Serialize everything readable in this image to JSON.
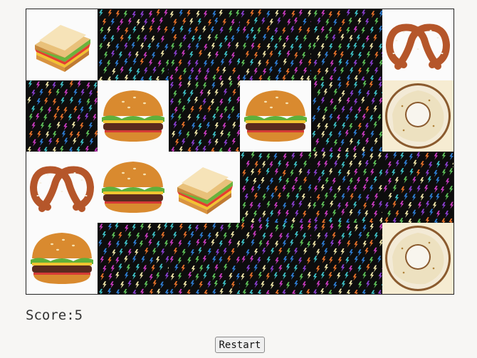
{
  "board": {
    "columns": 6,
    "rows": 4,
    "tiles": [
      "sandwich",
      "back",
      "back",
      "back",
      "back",
      "pretzel",
      "back",
      "burger",
      "back",
      "burger",
      "back",
      "bagel",
      "pretzel",
      "burger",
      "sandwich",
      "back",
      "back",
      "back",
      "burger",
      "back",
      "back",
      "back",
      "back",
      "bagel"
    ]
  },
  "score": {
    "label": "Score:",
    "value": "5"
  },
  "controls": {
    "restart_label": "Restart"
  },
  "colors": {
    "card_back": "#0d0d0d",
    "bolt_palette": [
      "#c93bc0",
      "#3fc3c9",
      "#f0e6a8",
      "#e8722a",
      "#8a3fd0",
      "#5fc35a",
      "#2f7fd6"
    ]
  }
}
